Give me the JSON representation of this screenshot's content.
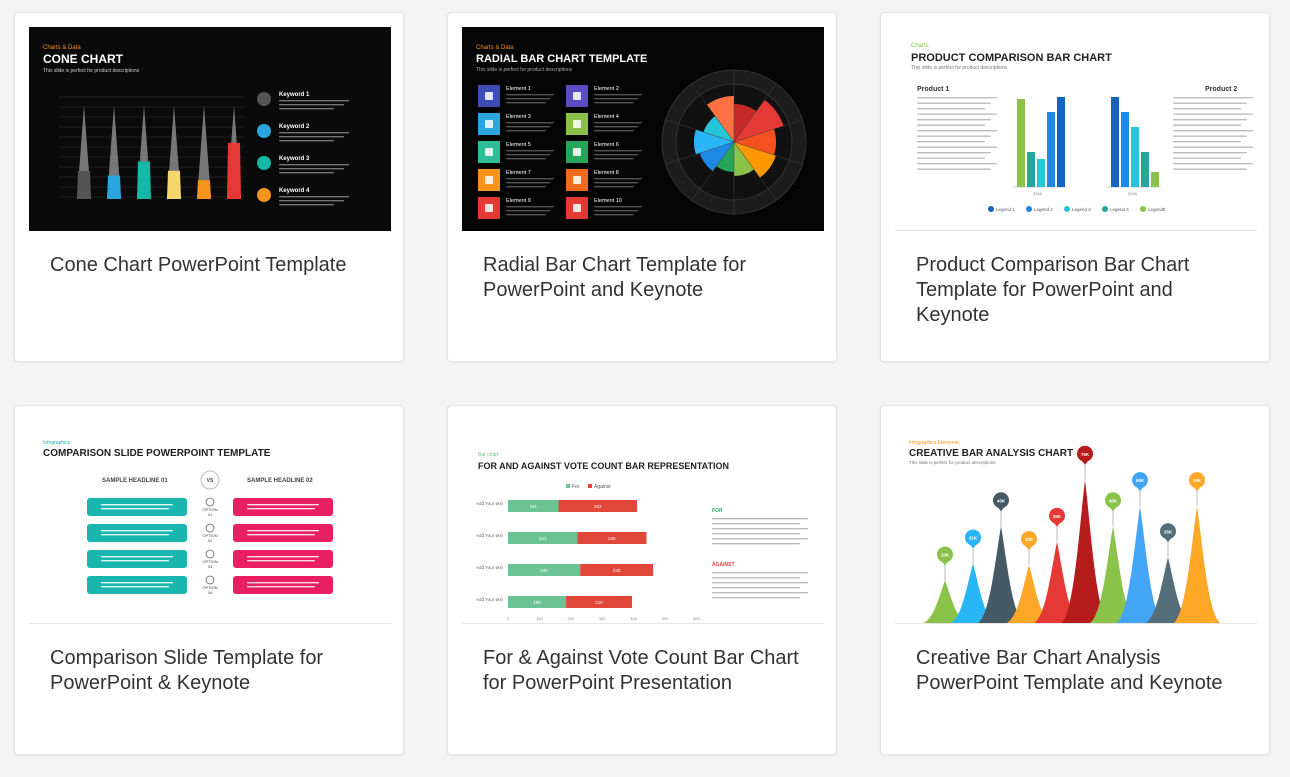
{
  "cards": [
    {
      "title": "Cone Chart PowerPoint Template",
      "thumb": {
        "category": "Charts & Data",
        "heading": "CONE CHART",
        "subtitle": "This slide is perfect for product descriptions",
        "keywords": [
          "Keyword 1",
          "Keyword 2",
          "Keyword 3",
          "Keyword 4"
        ],
        "cone_values": [
          0.9,
          0.9,
          0.9,
          0.9,
          0.9,
          0.9
        ],
        "cone_fill_fraction": [
          0.3,
          0.25,
          0.4,
          0.3,
          0.2,
          0.6
        ],
        "cone_colors": [
          "#555555",
          "#2aa6df",
          "#14b8a6",
          "#f5d76e",
          "#f7941d",
          "#e53935"
        ],
        "keyword_colors": [
          "#555555",
          "#2aa6df",
          "#14b8a6",
          "#f7941d"
        ]
      }
    },
    {
      "title": "Radial Bar Chart Template for PowerPoint and Keynote",
      "thumb": {
        "category": "Charts & Data",
        "heading": "RADIAL BAR CHART TEMPLATE",
        "subtitle": "This slide is perfect for product descriptions",
        "elements_left": [
          "Element 1",
          "Element 3",
          "Element 5",
          "Element 7",
          "Element 9"
        ],
        "elements_right": [
          "Element 2",
          "Element 4",
          "Element 6",
          "Element 8",
          "Element 10"
        ],
        "tile_colors_left": [
          "#3b4cb8",
          "#2aa6df",
          "#2ebd9b",
          "#f7941d",
          "#e53935"
        ],
        "tile_colors_right": [
          "#5b4cc4",
          "#8bc34a",
          "#26a65b",
          "#f26b1d",
          "#e53935"
        ],
        "slice_colors": [
          "#c62828",
          "#e53935",
          "#f4511e",
          "#ff9800",
          "#8bc34a",
          "#26a65b",
          "#1e88e5",
          "#29b6f6",
          "#26c6da",
          "#ff7043"
        ]
      }
    },
    {
      "title": "Product Comparison Bar Chart Template for PowerPoint and Keynote",
      "thumb": {
        "category": "Charts",
        "heading": "PRODUCT COMPARISON BAR CHART",
        "subtitle": "This slide is perfect for product descriptions",
        "product1": "Product 1",
        "product2": "Product 2",
        "years": [
          "2016",
          "2016"
        ],
        "legend": [
          "Legend 1",
          "Legend 2",
          "Legend 3",
          "Legend 4",
          "Legend5"
        ],
        "legend_colors": [
          "#1565c0",
          "#1e88e5",
          "#26c6da",
          "#26a69a",
          "#8bc34a"
        ]
      }
    },
    {
      "title": "Comparison Slide Template for PowerPoint & Keynote",
      "thumb": {
        "category": "Infographics",
        "heading": "COMPARISON SLIDE POWERPOINT TEMPLATE",
        "headline1": "SAMPLE HEADLINE 01",
        "headline2": "SAMPLE HEADLINE 02",
        "vs": "VS",
        "options": [
          "OPTION 01",
          "OPTION 02",
          "OPTION 03",
          "OPTION 04"
        ],
        "left_color": "#19b6b0",
        "right_color": "#e91e63"
      }
    },
    {
      "title": "For & Against Vote Count Bar Chart for PowerPoint Presentation",
      "thumb": {
        "category": "Bar chart",
        "heading": "FOR AND AGAINST VOTE COUNT BAR REPRESENTATION",
        "legend_for": "For",
        "legend_against": "Against",
        "row_label": "Add Your text",
        "for_values": [
          161,
          221,
          230,
          185
        ],
        "against_values": [
          252,
          245,
          233,
          210
        ],
        "for_total": [
          411,
          441,
          462,
          395
        ],
        "label_for": "FOR",
        "label_against": "AGAINST",
        "axis_ticks": [
          "0",
          "100",
          "200",
          "300",
          "400",
          "500",
          "600"
        ],
        "for_color": "#6cc495",
        "against_color": "#e0463a"
      }
    },
    {
      "title": "Creative Bar Chart Analysis PowerPoint Template and Keynote",
      "thumb": {
        "category": "Infographics Elements",
        "heading": "CREATIVE BAR ANALYSIS CHART",
        "subtitle": "This slide is perfect for product descriptions",
        "peaks": [
          "10K",
          "21K",
          "45K",
          "20K",
          "35K",
          "75K",
          "45K",
          "58K",
          "25K",
          "58K"
        ],
        "peak_colors": [
          "#8bc34a",
          "#29b6f6",
          "#455a64",
          "#ffa726",
          "#e53935",
          "#b71c1c",
          "#8bc34a",
          "#42a5f5",
          "#546e7a",
          "#ffa726"
        ]
      }
    }
  ]
}
